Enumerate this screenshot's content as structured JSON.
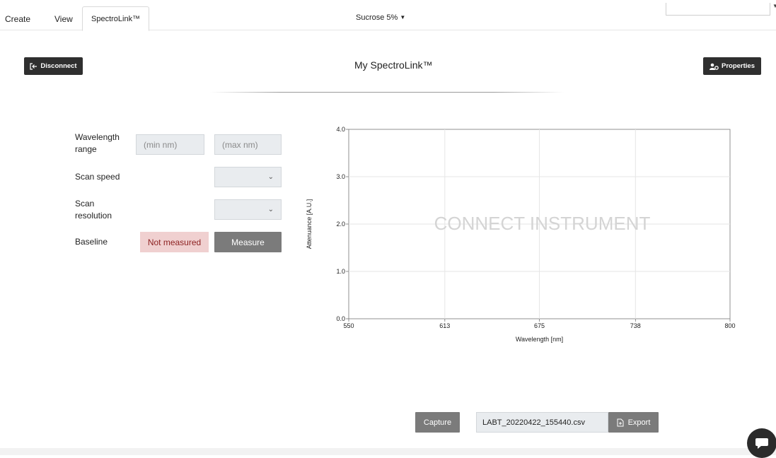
{
  "nav": {
    "tabs": [
      {
        "label": "Create"
      },
      {
        "label": "View"
      },
      {
        "label": "SpectroLink™"
      }
    ],
    "active_tab": "SpectroLink™",
    "document_selector": "Sucrose 5%",
    "top_right_input_value": ""
  },
  "header": {
    "disconnect_label": "Disconnect",
    "title": "My SpectroLink™",
    "properties_label": "Properties"
  },
  "form": {
    "wavelength_label_line1": "Wavelength",
    "wavelength_label_line2": "range",
    "min_placeholder": "(min nm)",
    "max_placeholder": "(max nm)",
    "scan_speed_label": "Scan speed",
    "scan_speed_value": "",
    "scan_resolution_label_line1": "Scan",
    "scan_resolution_label_line2": "resolution",
    "scan_resolution_value": "",
    "baseline_label": "Baseline",
    "baseline_status": "Not measured",
    "measure_label": "Measure"
  },
  "chart_data": {
    "type": "line",
    "series": [],
    "xlabel": "Wavelength [nm]",
    "ylabel": "Attenuance [A.U.]",
    "x_ticks": [
      "550",
      "613",
      "675",
      "738",
      "800"
    ],
    "y_ticks": [
      "0.0",
      "1.0",
      "2.0",
      "3.0",
      "4.0"
    ],
    "xlim": [
      550,
      800
    ],
    "ylim": [
      0,
      4
    ],
    "grid": true,
    "overlay_text": "CONNECT INSTRUMENT"
  },
  "footer": {
    "capture_label": "Capture",
    "filename_value": "LABT_20220422_155440.csv",
    "export_label": "Export"
  },
  "colors": {
    "dark_button": "#2f2f2f",
    "gray_button": "#7b7b7b",
    "field_bg": "#e9ecef",
    "warning_bg": "#f0d0d0",
    "warning_text": "#8e2323"
  }
}
